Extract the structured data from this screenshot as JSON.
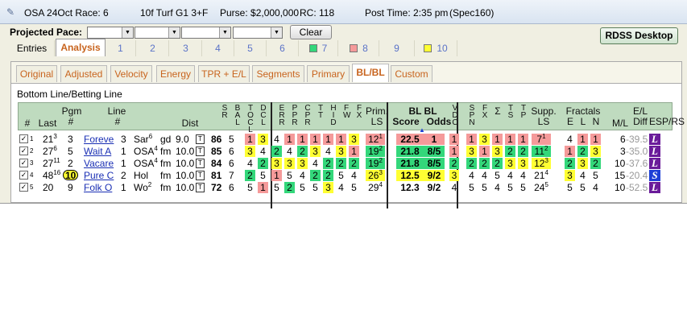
{
  "title": {
    "race": "OSA 24Oct Race: 6",
    "info": "10f  Turf  G1  3+F",
    "purse": "Purse: $2,000,000",
    "rc": "RC: 118",
    "post_time": "Post Time: 2:35 pm",
    "spec": "(Spec160)"
  },
  "toolbar": {
    "pace_label": "Projected Pace:",
    "clear_label": "Clear",
    "rdss_label": "RDSS Desktop"
  },
  "tabs": [
    {
      "label": "Entries"
    },
    {
      "label": "Analysis"
    },
    {
      "label": "1"
    },
    {
      "label": "2"
    },
    {
      "label": "3"
    },
    {
      "label": "4"
    },
    {
      "label": "5"
    },
    {
      "label": "6"
    },
    {
      "label": "7",
      "swatch": "#33d77a"
    },
    {
      "label": "8",
      "swatch": "#f59a9a"
    },
    {
      "label": "9"
    },
    {
      "label": "10",
      "swatch": "#ffff33"
    }
  ],
  "subtabs": [
    "Original",
    "Adjusted",
    "Velocity",
    "Energy",
    "TPR + E/L",
    "Segments",
    "Primary",
    "BL/BL",
    "Custom"
  ],
  "section_title": "Bottom Line/Betting Line",
  "headers": {
    "num": "#",
    "pgm": "Pgm",
    "last": "Last",
    "pgm_num": "#",
    "line": "Line",
    "line_num": "#",
    "dist": "Dist",
    "sr": "S R",
    "bal": "B A L",
    "tocl": "T O C L",
    "docl": "D C L",
    "err": "E R R",
    "ppr": "P P R",
    "cpr": "C P R",
    "tt": "T T",
    "hid": "H I D",
    "fw": "F W",
    "fx": "F X",
    "prim": "Prim.",
    "ls": "LS",
    "bl1": "BL  BL",
    "score": "Score",
    "odds": "Odds",
    "vdc": "V D C",
    "spn": "S P N",
    "fx2": "F X",
    "sigma": "Σ",
    "ts": "T S",
    "tp": "T P",
    "supp": "Supp.",
    "ls2": "LS",
    "fractals": "Fractals",
    "e": "E",
    "l": "L",
    "n": "N",
    "ml": "M/L",
    "el": "E/L",
    "diff": "Diff",
    "esp": "ESP/RS"
  },
  "rows": [
    {
      "n": "1",
      "last": "21",
      "last_sup": "3",
      "pgm": "3",
      "name": "Foreve",
      "line": "3",
      "track": "Sar",
      "track_sup": "6",
      "surf": "gd",
      "dist": "9.0",
      "sr": "86",
      "bal": "5",
      "cells": [
        [
          "1",
          "pk"
        ],
        [
          "3",
          "yl"
        ],
        [
          "4",
          "wh"
        ],
        [
          "1",
          "pk"
        ],
        [
          "1",
          "pk"
        ],
        [
          "1",
          "pk"
        ],
        [
          "1",
          "pk"
        ],
        [
          "1",
          "pk"
        ],
        [
          "3",
          "yl"
        ]
      ],
      "prim": "12",
      "prim_sup": "1",
      "prim_c": "pk",
      "score": "22.5",
      "odds": "1",
      "bl_c": "pk",
      "vdc": "1",
      "vdc_c": "pk",
      "supp": [
        [
          "1",
          "pk"
        ],
        [
          "3",
          "yl"
        ],
        [
          "1",
          "pk"
        ],
        [
          "1",
          "pk"
        ],
        [
          "1",
          "pk"
        ]
      ],
      "sls": "7",
      "sls_sup": "1",
      "sls_c": "pk",
      "frac": [
        [
          "4",
          "wh"
        ],
        [
          "1",
          "pk"
        ],
        [
          "1",
          "pk"
        ]
      ],
      "ml": "6",
      "el": "-39.5",
      "esp": "L",
      "esp_c": "#6a1b9a"
    },
    {
      "n": "2",
      "last": "27",
      "last_sup": "6",
      "pgm": "5",
      "name": "Wait A",
      "line": "1",
      "track": "OSA",
      "track_sup": "4",
      "surf": "fm",
      "dist": "10.0",
      "sr": "85",
      "bal": "6",
      "cells": [
        [
          "3",
          "yl"
        ],
        [
          "4",
          "wh"
        ],
        [
          "2",
          "gr"
        ],
        [
          "4",
          "wh"
        ],
        [
          "2",
          "gr"
        ],
        [
          "3",
          "yl"
        ],
        [
          "4",
          "wh"
        ],
        [
          "3",
          "yl"
        ],
        [
          "1",
          "pk"
        ]
      ],
      "prim": "19",
      "prim_sup": "2",
      "prim_c": "gr",
      "score": "21.8",
      "odds": "8/5",
      "bl_c": "gr",
      "vdc": "1",
      "vdc_c": "pk",
      "supp": [
        [
          "3",
          "yl"
        ],
        [
          "1",
          "pk"
        ],
        [
          "3",
          "yl"
        ],
        [
          "2",
          "gr"
        ],
        [
          "2",
          "gr"
        ]
      ],
      "sls": "11",
      "sls_sup": "2",
      "sls_c": "gr",
      "frac": [
        [
          "1",
          "pk"
        ],
        [
          "2",
          "gr"
        ],
        [
          "3",
          "yl"
        ]
      ],
      "ml": "3",
      "el": "-35.0",
      "esp": "L",
      "esp_c": "#6a1b9a"
    },
    {
      "n": "3",
      "last": "27",
      "last_sup": "11",
      "pgm": "2",
      "name": "Vacare",
      "line": "1",
      "track": "OSA",
      "track_sup": "4",
      "surf": "fm",
      "dist": "10.0",
      "sr": "84",
      "bal": "6",
      "cells": [
        [
          "4",
          "wh"
        ],
        [
          "2",
          "gr"
        ],
        [
          "3",
          "yl"
        ],
        [
          "3",
          "yl"
        ],
        [
          "3",
          "yl"
        ],
        [
          "4",
          "wh"
        ],
        [
          "2",
          "gr"
        ],
        [
          "2",
          "gr"
        ],
        [
          "2",
          "gr"
        ]
      ],
      "prim": "19",
      "prim_sup": "2",
      "prim_c": "gr",
      "score": "21.8",
      "odds": "8/5",
      "bl_c": "gr",
      "vdc": "2",
      "vdc_c": "gr",
      "supp": [
        [
          "2",
          "gr"
        ],
        [
          "2",
          "gr"
        ],
        [
          "2",
          "gr"
        ],
        [
          "3",
          "yl"
        ],
        [
          "3",
          "yl"
        ]
      ],
      "sls": "12",
      "sls_sup": "3",
      "sls_c": "yl",
      "frac": [
        [
          "2",
          "gr"
        ],
        [
          "3",
          "yl"
        ],
        [
          "2",
          "gr"
        ]
      ],
      "ml": "10",
      "el": "-37.6",
      "esp": "L",
      "esp_c": "#6a1b9a"
    },
    {
      "n": "4",
      "last": "48",
      "last_sup": "16",
      "pgm": "10",
      "name": "Pure C",
      "line": "2",
      "track": "Hol",
      "track_sup": "",
      "surf": "fm",
      "dist": "10.0",
      "sr": "81",
      "bal": "7",
      "cells": [
        [
          "2",
          "gr"
        ],
        [
          "5",
          "wh"
        ],
        [
          "1",
          "pk"
        ],
        [
          "5",
          "wh"
        ],
        [
          "4",
          "wh"
        ],
        [
          "2",
          "gr"
        ],
        [
          "2",
          "gr"
        ],
        [
          "5",
          "wh"
        ],
        [
          "4",
          "wh"
        ]
      ],
      "prim": "26",
      "prim_sup": "3",
      "prim_c": "yl",
      "score": "12.5",
      "odds": "9/2",
      "bl_c": "yl",
      "vdc": "3",
      "vdc_c": "yl",
      "supp": [
        [
          "4",
          "wh"
        ],
        [
          "4",
          "wh"
        ],
        [
          "5",
          "wh"
        ],
        [
          "4",
          "wh"
        ],
        [
          "4",
          "wh"
        ]
      ],
      "sls": "21",
      "sls_sup": "4",
      "sls_c": "wh",
      "frac": [
        [
          "3",
          "yl"
        ],
        [
          "4",
          "wh"
        ],
        [
          "5",
          "wh"
        ]
      ],
      "ml": "15",
      "el": "-20.4",
      "esp": "S",
      "esp_c": "#1e3fd6"
    },
    {
      "n": "5",
      "last": "20",
      "last_sup": "",
      "pgm": "9",
      "name": "Folk O",
      "line": "1",
      "track": "Wo",
      "track_sup": "2",
      "surf": "fm",
      "dist": "10.0",
      "sr": "72",
      "bal": "6",
      "cells": [
        [
          "5",
          "wh"
        ],
        [
          "1",
          "pk"
        ],
        [
          "5",
          "wh"
        ],
        [
          "2",
          "gr"
        ],
        [
          "5",
          "wh"
        ],
        [
          "5",
          "wh"
        ],
        [
          "3",
          "yl"
        ],
        [
          "4",
          "wh"
        ],
        [
          "5",
          "wh"
        ]
      ],
      "prim": "29",
      "prim_sup": "4",
      "prim_c": "wh",
      "score": "12.3",
      "odds": "9/2",
      "bl_c": "wh",
      "vdc": "4",
      "vdc_c": "wh",
      "supp": [
        [
          "5",
          "wh"
        ],
        [
          "5",
          "wh"
        ],
        [
          "4",
          "wh"
        ],
        [
          "5",
          "wh"
        ],
        [
          "5",
          "wh"
        ]
      ],
      "sls": "24",
      "sls_sup": "5",
      "sls_c": "wh",
      "frac": [
        [
          "5",
          "wh"
        ],
        [
          "5",
          "wh"
        ],
        [
          "4",
          "wh"
        ]
      ],
      "ml": "10",
      "el": "-52.5",
      "esp": "L",
      "esp_c": "#6a1b9a"
    }
  ]
}
